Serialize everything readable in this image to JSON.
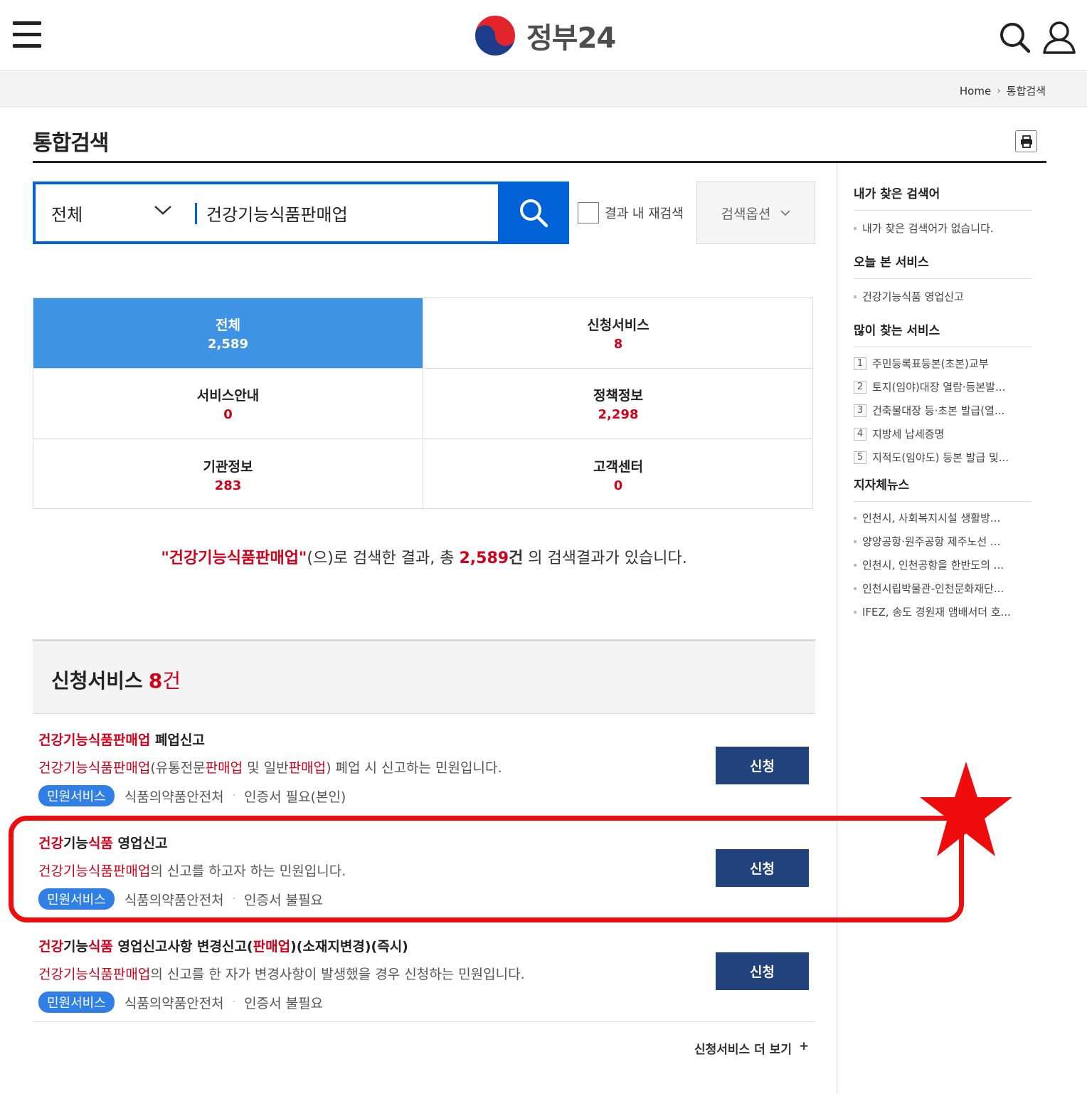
{
  "header": {
    "logo_text": "정부24",
    "menu_icon": "hamburger-menu-icon",
    "search_icon": "search-icon",
    "user_icon": "user-icon"
  },
  "breadcrumb": {
    "home": "Home",
    "current": "통합검색"
  },
  "page": {
    "title": "통합검색"
  },
  "search": {
    "scope": "전체",
    "query": "건강기능식품판매업",
    "research_label": "결과 내 재검색",
    "options_label": "검색옵션"
  },
  "categories": [
    {
      "name": "전체",
      "count": "2,589"
    },
    {
      "name": "신청서비스",
      "count": "8"
    },
    {
      "name": "서비스안내",
      "count": "0"
    },
    {
      "name": "정책정보",
      "count": "2,298"
    },
    {
      "name": "기관정보",
      "count": "283"
    },
    {
      "name": "고객센터",
      "count": "0"
    }
  ],
  "summary": {
    "keyword": "\"건강기능식품판매업\"",
    "mid": "(으)로 검색한 결과, 총 ",
    "total": "2,589",
    "unit": "건",
    "tail": " 의 검색결과가 있습니다."
  },
  "section": {
    "title": "신청서비스",
    "count": "8",
    "unit": "건"
  },
  "results": [
    {
      "title_hl": "건강기능식품판매업",
      "title_rest": " 폐업신고",
      "desc_hl1": "건강기능식품판매업",
      "desc_p1": "(유통전문",
      "desc_hl2": "판매업",
      "desc_p2": " 및 일반",
      "desc_hl3": "판매업",
      "desc_p3": ") 폐업 시 신고하는 민원입니다.",
      "badge": "민원서비스",
      "agency": "식품의약품안전처",
      "cert": "인증서 필요(본인)",
      "button": "신청"
    },
    {
      "title_hl1": "건강",
      "title_p1": "기능",
      "title_hl2": "식품",
      "title_rest": " 영업신고",
      "desc_hl": "건강기능식품판매업",
      "desc_rest": "의 신고를 하고자 하는 민원입니다.",
      "badge": "민원서비스",
      "agency": "식품의약품안전처",
      "cert": "인증서 불필요",
      "button": "신청"
    },
    {
      "title_hl1": "건강",
      "title_p1": "기능",
      "title_hl2": "식품",
      "title_p2": " 영업신고사항 변경신고(",
      "title_hl3": "판매업",
      "title_p3": ")(소재지변경)(즉시)",
      "desc_hl": "건강기능식품판매업",
      "desc_rest": "의 신고를 한 자가 변경사항이 발생했을 경우 신청하는 민원입니다.",
      "badge": "민원서비스",
      "agency": "식품의약품안전처",
      "cert": "인증서 불필요",
      "button": "신청"
    }
  ],
  "more_label": "신청서비스 더 보기",
  "more_icon": "+",
  "sidebar": {
    "my_searches": {
      "title": "내가 찾은 검색어",
      "empty": "내가 찾은 검색어가 없습니다."
    },
    "today_viewed": {
      "title": "오늘 본 서비스",
      "items": [
        "건강기능식품 영업신고"
      ]
    },
    "popular": {
      "title": "많이 찾는 서비스",
      "items": [
        {
          "rank": "1",
          "label": "주민등록표등본(초본)교부"
        },
        {
          "rank": "2",
          "label": "토지(임야)대장 열람·등본발..."
        },
        {
          "rank": "3",
          "label": "건축물대장 등·초본 발급(열..."
        },
        {
          "rank": "4",
          "label": "지방세 납세증명"
        },
        {
          "rank": "5",
          "label": "지적도(임야도) 등본 발급 및..."
        }
      ]
    },
    "news": {
      "title": "지자체뉴스",
      "items": [
        "인천시, 사회복지시설 생활방...",
        "양양공항·원주공항 제주노선 ...",
        "인천시, 인천공항을 한반도의 ...",
        "인천시립박물관-인천문화재단...",
        "IFEZ, 송도 경원재 앰배서더 호..."
      ]
    }
  },
  "colors": {
    "primary": "#0062d6",
    "active_tab": "#3f93e4",
    "highlight": "#d0021b",
    "apply_button": "#22427e",
    "annotation_red": "#ee0c0c"
  }
}
